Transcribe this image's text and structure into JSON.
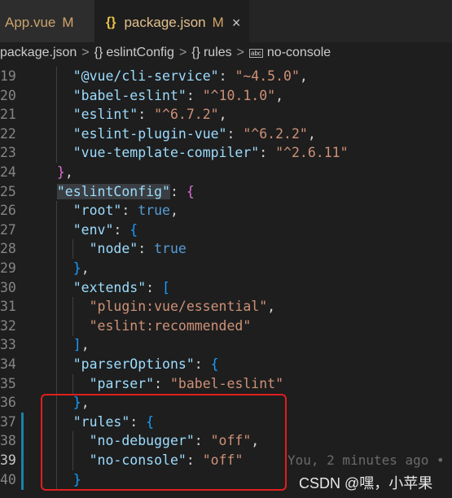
{
  "tabs": [
    {
      "label": "App.vue",
      "modified": "M",
      "icon": "",
      "active": false
    },
    {
      "label": "package.json",
      "modified": "M",
      "icon": "{}",
      "active": true,
      "close": "×"
    }
  ],
  "breadcrumb": {
    "file": "package.json",
    "items": [
      "eslintConfig",
      "rules",
      "no-console"
    ],
    "separator": ">"
  },
  "lines": [
    {
      "n": "19",
      "code": "    \"@vue/cli-service\": \"~4.5.0\","
    },
    {
      "n": "20",
      "code": "    \"babel-eslint\": \"^10.1.0\","
    },
    {
      "n": "21",
      "code": "    \"eslint\": \"^6.7.2\","
    },
    {
      "n": "22",
      "code": "    \"eslint-plugin-vue\": \"^6.2.2\","
    },
    {
      "n": "23",
      "code": "    \"vue-template-compiler\": \"^2.6.11\""
    },
    {
      "n": "24",
      "code": "  },"
    },
    {
      "n": "25",
      "code": "  \"eslintConfig\": {"
    },
    {
      "n": "26",
      "code": "    \"root\": true,"
    },
    {
      "n": "27",
      "code": "    \"env\": {"
    },
    {
      "n": "28",
      "code": "      \"node\": true"
    },
    {
      "n": "29",
      "code": "    },"
    },
    {
      "n": "30",
      "code": "    \"extends\": ["
    },
    {
      "n": "31",
      "code": "      \"plugin:vue/essential\","
    },
    {
      "n": "32",
      "code": "      \"eslint:recommended\""
    },
    {
      "n": "33",
      "code": "    ],"
    },
    {
      "n": "34",
      "code": "    \"parserOptions\": {"
    },
    {
      "n": "35",
      "code": "      \"parser\": \"babel-eslint\""
    },
    {
      "n": "36",
      "code": "    },"
    },
    {
      "n": "37",
      "code": "    \"rules\": {"
    },
    {
      "n": "38",
      "code": "      \"no-debugger\": \"off\","
    },
    {
      "n": "39",
      "code": "      \"no-console\": \"off\""
    },
    {
      "n": "40",
      "code": "    }"
    }
  ],
  "blame": "You, 2 minutes ago •",
  "watermark": "CSDN @嘿，小苹果",
  "colors": {
    "key": "#9cdcfe",
    "string": "#ce9178",
    "boolean": "#569cd6",
    "highlight_box": "#e0201e",
    "modified_tab": "#e2c08d"
  }
}
